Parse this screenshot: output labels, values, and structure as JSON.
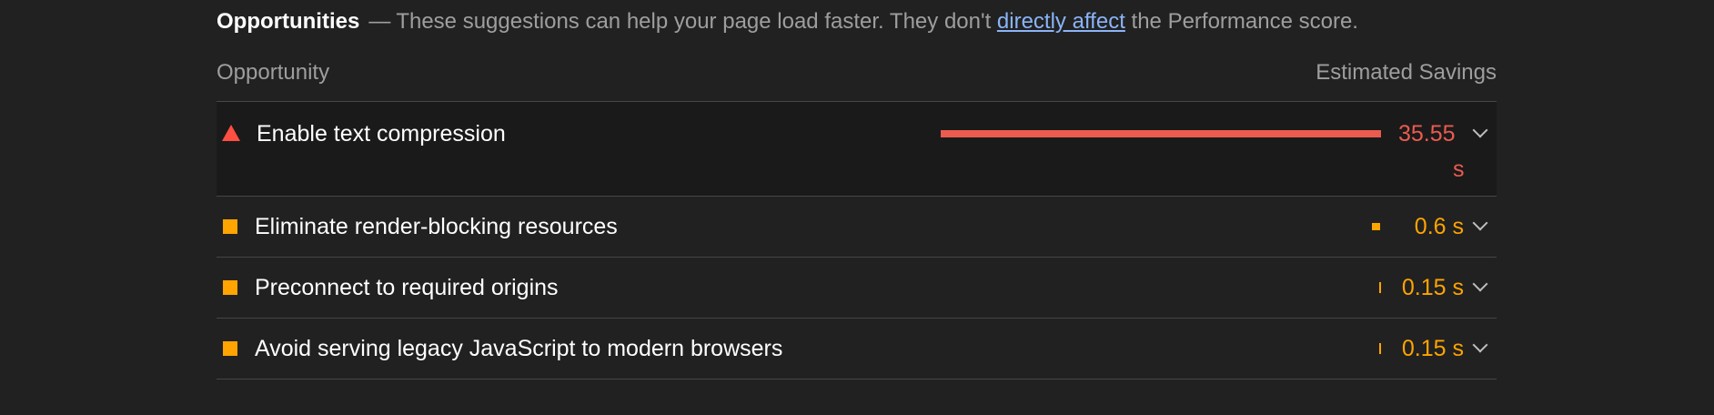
{
  "group": {
    "title": "Opportunities",
    "separator": "—",
    "description_before": "These suggestions can help your page load faster. They don't",
    "link": "directly affect",
    "description_after": "the Performance score."
  },
  "columns": {
    "opportunity": "Opportunity",
    "savings": "Estimated Savings"
  },
  "rows": [
    {
      "title": "Enable text compression",
      "value_main": "35.55",
      "value_unit": "s",
      "severity": "fail",
      "icon": "triangle-warning-icon"
    },
    {
      "title": "Eliminate render-blocking resources",
      "value": "0.6 s",
      "severity": "average",
      "icon": "square-average-icon"
    },
    {
      "title": "Preconnect to required origins",
      "value": "0.15 s",
      "severity": "average",
      "icon": "square-average-icon"
    },
    {
      "title": "Avoid serving legacy JavaScript to modern browsers",
      "value": "0.15 s",
      "severity": "average",
      "icon": "square-average-icon"
    }
  ],
  "colors": {
    "fail": "#eb5b4f",
    "average": "#ffa400",
    "link": "#8ab4f8",
    "background": "#212121"
  }
}
